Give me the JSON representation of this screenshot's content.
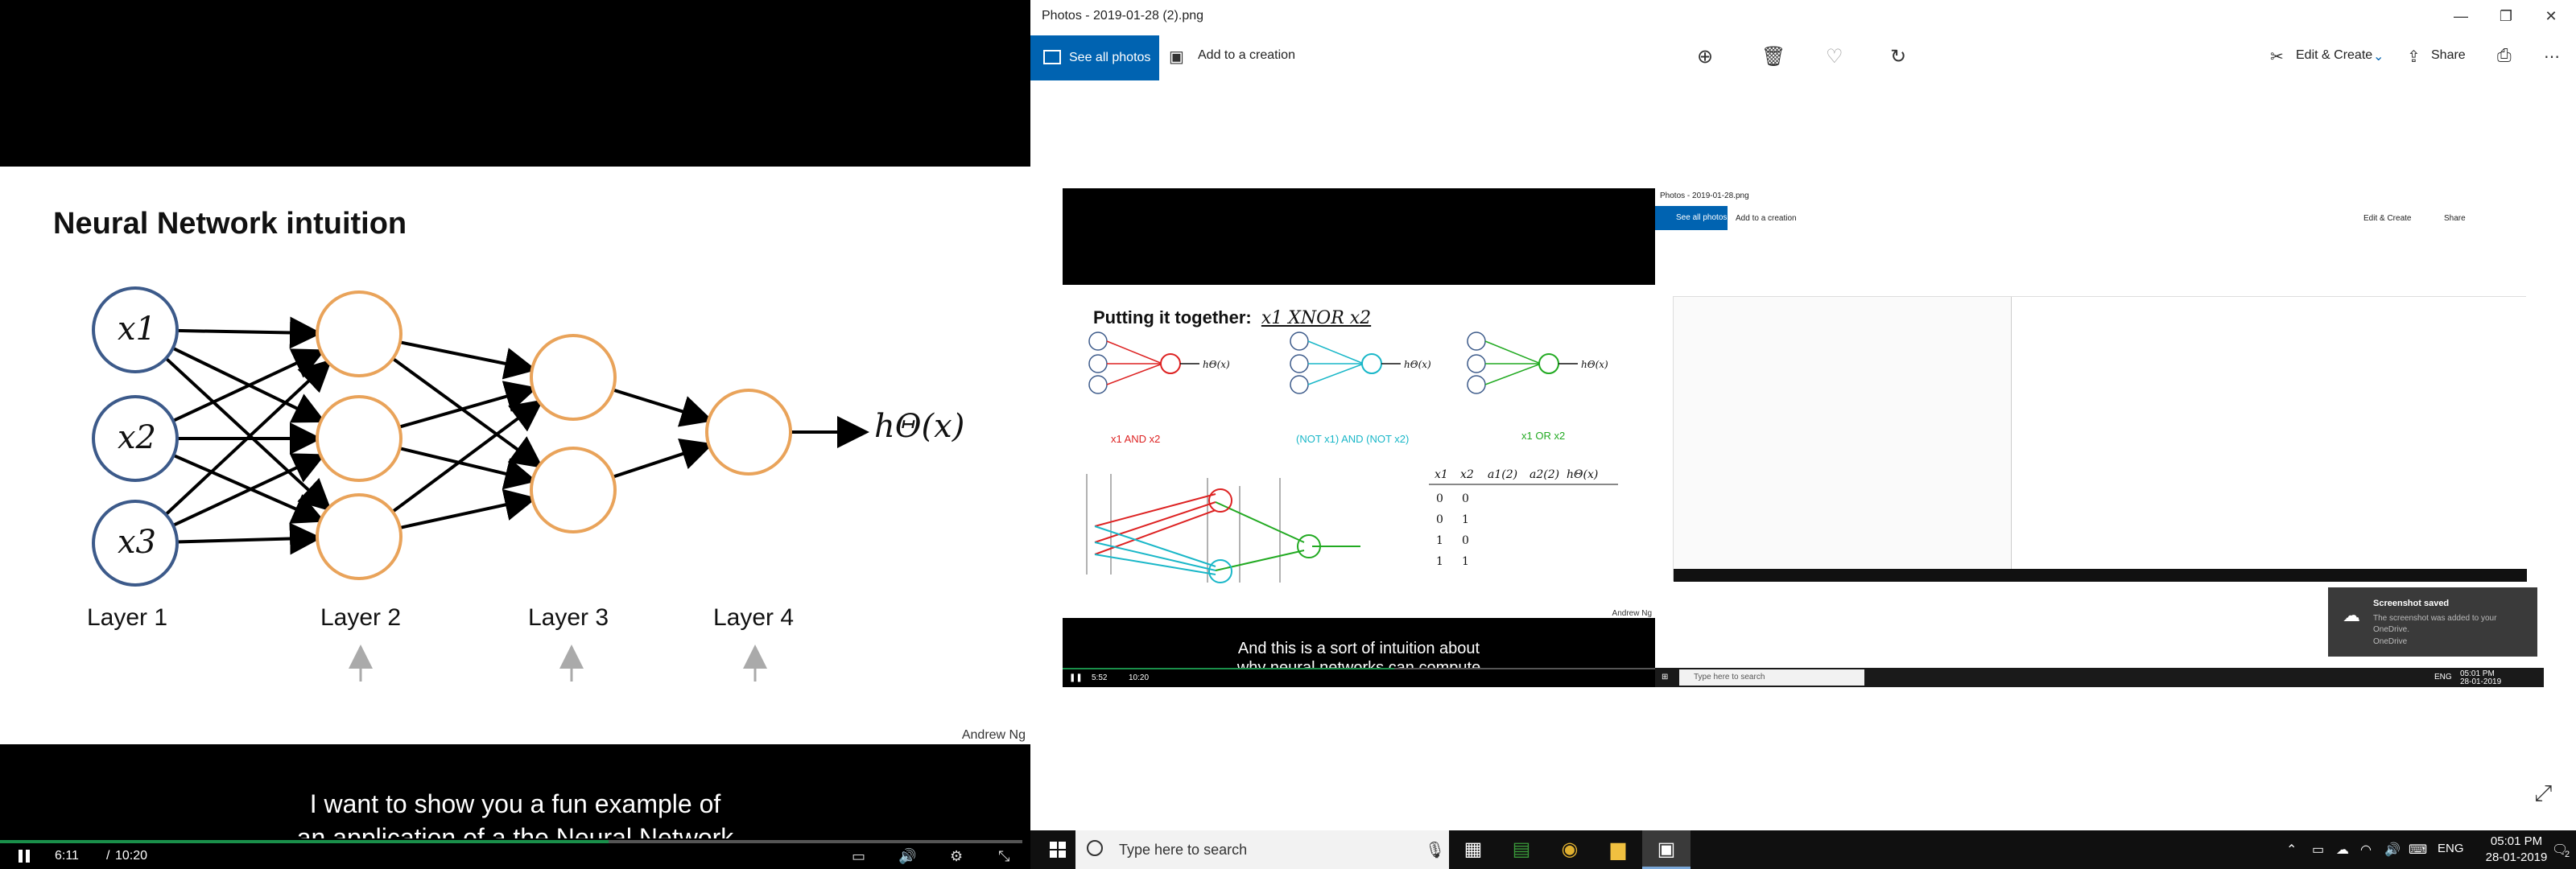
{
  "left_video": {
    "slide_title": "Neural Network intuition",
    "inputs": [
      "x1",
      "x2",
      "x3"
    ],
    "output_label": "hΘ(x)",
    "layers": [
      "Layer 1",
      "Layer 2",
      "Layer 3",
      "Layer 4"
    ],
    "author": "Andrew Ng",
    "subtitle_line1": "I want to show you a fun example of",
    "subtitle_line2": "an application of a the Neural Network",
    "time_current": "6:11",
    "time_separator": "/",
    "time_total": "10:20",
    "progress": 0.595
  },
  "photos_window": {
    "title": "Photos - 2019-01-28 (2).png",
    "see_all_label": "See all photos",
    "add_creation_label": "Add to a creation",
    "edit_create_label": "Edit & Create",
    "share_label": "Share",
    "controls": {
      "minimize": "—",
      "maximize": "❐",
      "close": "✕"
    }
  },
  "nested": {
    "slide_title": "Putting it together:",
    "slide_title_math": "x1 XNOR x2",
    "labels": {
      "and": "x1 AND x2",
      "not_and_not": "(NOT x1) AND (NOT x2)",
      "or": "x1 OR x2",
      "h": "hΘ(x)"
    },
    "table_headers": [
      "x1",
      "x2",
      "a1(2)",
      "a2(2)",
      "hΘ(x)"
    ],
    "table_rows": [
      [
        "0",
        "0"
      ],
      [
        "0",
        "1"
      ],
      [
        "1",
        "0"
      ],
      [
        "1",
        "1"
      ]
    ],
    "author": "Andrew Ng",
    "subtitle_line1": "And this is a sort of intuition about",
    "subtitle_line2": "why neural networks can compute",
    "time_current": "5:52",
    "time_total": "10:20",
    "photos_title": "Photos - 2019-01-28.png",
    "see_all_label": "See all photos",
    "add_creation_label": "Add to a creation",
    "edit_create_label": "Edit & Create",
    "share_label": "Share",
    "toast_title": "Screenshot saved",
    "toast_body": "The screenshot was added to your OneDrive.",
    "toast_source": "OneDrive",
    "search_placeholder": "Type here to search",
    "lang": "ENG",
    "time": "05:01 PM",
    "date": "28-01-2019"
  },
  "taskbar": {
    "search_placeholder": "Type here to search",
    "lang": "ENG",
    "time": "05:01 PM",
    "date": "28-01-2019",
    "notifications": "2"
  }
}
